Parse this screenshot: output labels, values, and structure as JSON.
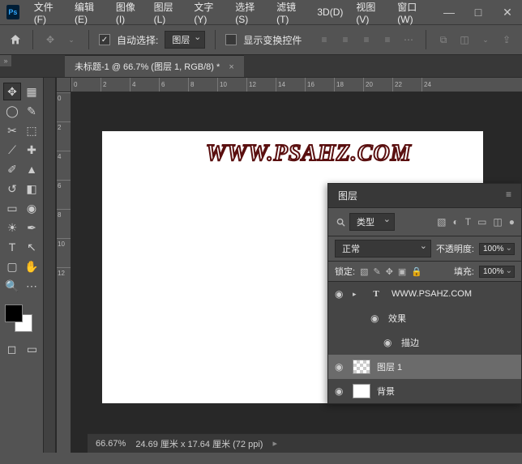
{
  "menu": [
    "文件(F)",
    "编辑(E)",
    "图像(I)",
    "图层(L)",
    "文字(Y)",
    "选择(S)",
    "滤镜(T)",
    "3D(D)",
    "视图(V)",
    "窗口(W)"
  ],
  "options": {
    "auto_select": "自动选择:",
    "target": "图层",
    "show_transform": "显示变换控件"
  },
  "tab": {
    "title": "未标题-1 @ 66.7% (图层 1, RGB/8) *"
  },
  "ruler_h": [
    "0",
    "2",
    "4",
    "6",
    "8",
    "10",
    "12",
    "14",
    "16",
    "18",
    "20",
    "22",
    "24"
  ],
  "ruler_v": [
    "0",
    "2",
    "4",
    "6",
    "8",
    "10",
    "12"
  ],
  "canvas": {
    "text": "WWW.PSAHZ.COM"
  },
  "layers_panel": {
    "title": "图层",
    "filter_label": "类型",
    "blend_mode": "正常",
    "opacity_label": "不透明度:",
    "opacity_value": "100%",
    "lock_label": "锁定:",
    "fill_label": "填充:",
    "fill_value": "100%",
    "items": [
      {
        "name": "WWW.PSAHZ.COM",
        "type": "text"
      },
      {
        "name": "效果",
        "type": "fx-group"
      },
      {
        "name": "描边",
        "type": "fx"
      },
      {
        "name": "图层 1",
        "type": "raster",
        "selected": true
      },
      {
        "name": "背景",
        "type": "bg"
      }
    ]
  },
  "status": {
    "zoom": "66.67%",
    "doc": "24.69 厘米 x 17.64 厘米 (72 ppi)"
  }
}
